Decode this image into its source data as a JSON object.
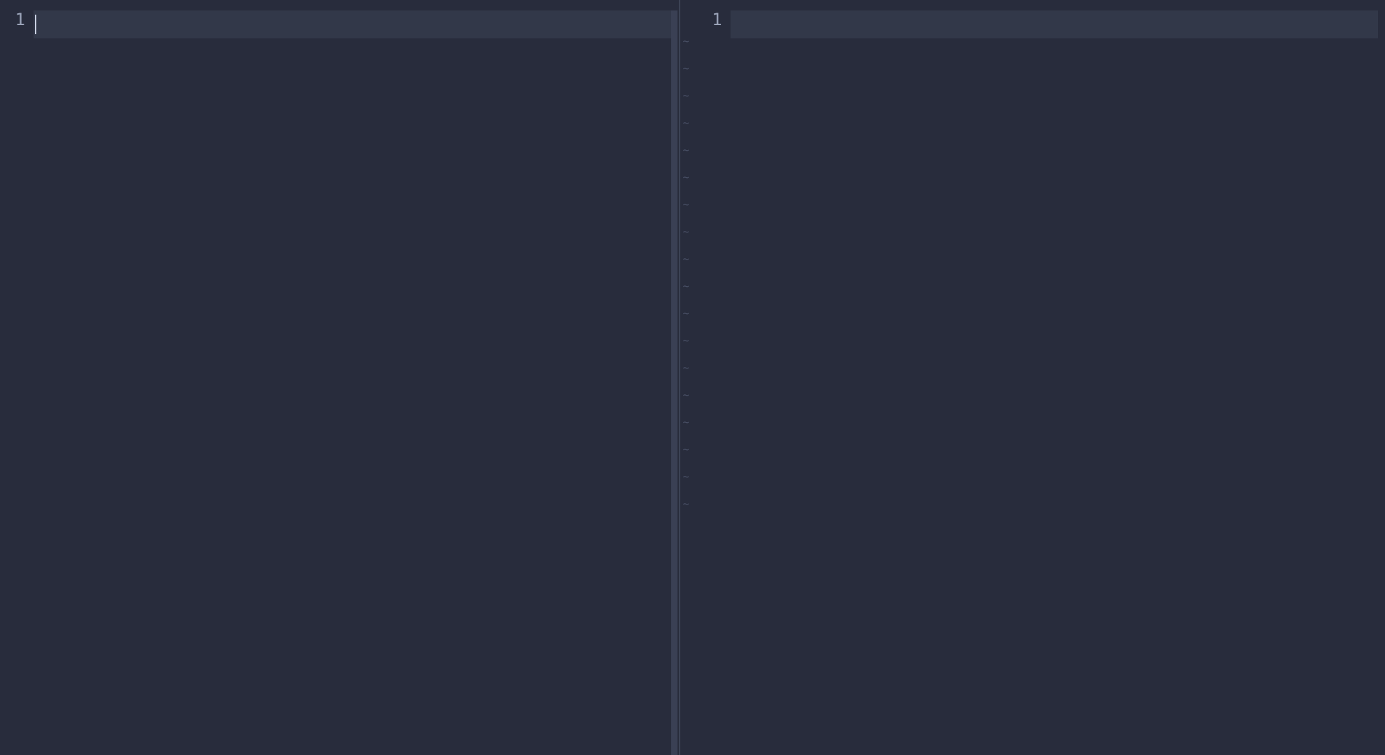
{
  "panes": {
    "left": {
      "line_number": "1",
      "content": ""
    },
    "right": {
      "line_number": "1",
      "content": ""
    }
  },
  "tilde_glyph": "~",
  "tilde_count": 18
}
